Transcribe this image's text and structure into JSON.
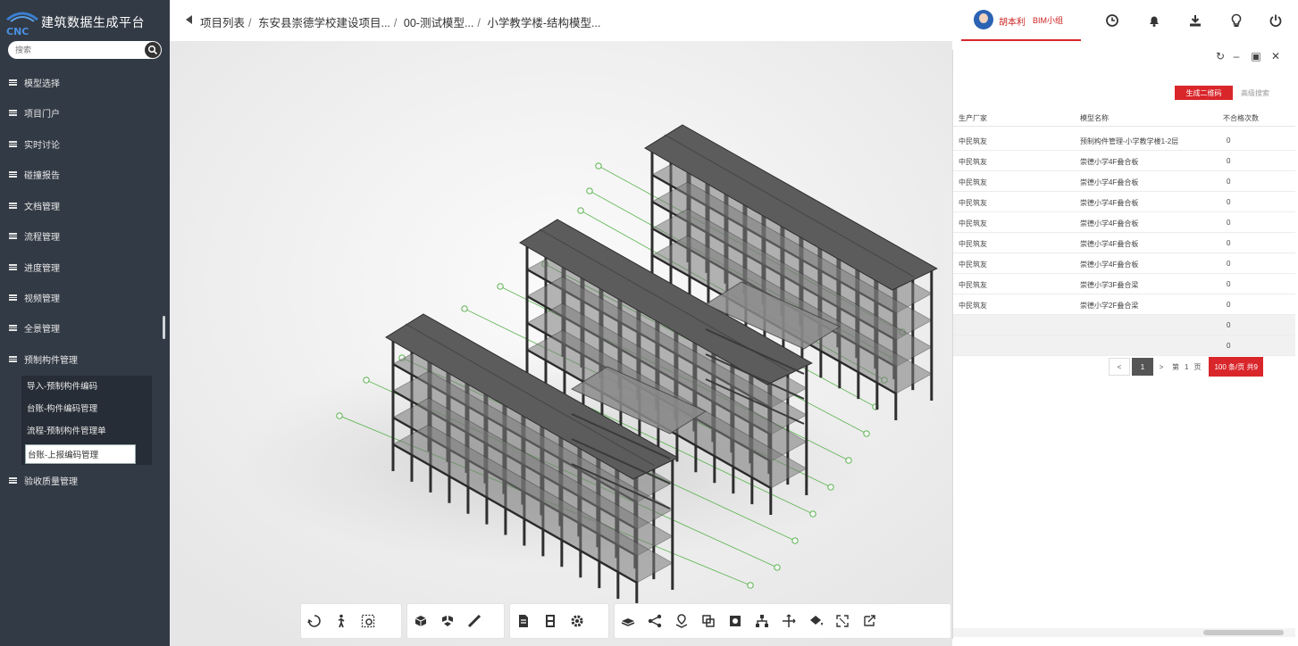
{
  "app": {
    "title": "建筑数据生成平台",
    "logo_text": "CNC"
  },
  "search": {
    "placeholder": "搜索"
  },
  "sidebar": {
    "items": [
      {
        "label": "模型选择"
      },
      {
        "label": "项目门户"
      },
      {
        "label": "实时讨论"
      },
      {
        "label": "碰撞报告"
      },
      {
        "label": "文档管理"
      },
      {
        "label": "流程管理"
      },
      {
        "label": "进度管理"
      },
      {
        "label": "视频管理"
      },
      {
        "label": "全景管理"
      },
      {
        "label": "预制构件管理"
      },
      {
        "label": "验收质量管理"
      }
    ],
    "submenu": [
      {
        "label": "导入-预制构件编码"
      },
      {
        "label": "台账-构件编码管理"
      },
      {
        "label": "流程-预制构件管理单"
      },
      {
        "label": "台账-上报编码管理"
      }
    ]
  },
  "breadcrumb": {
    "items": [
      "项目列表",
      "东安县崇德学校建设项目...",
      "00-测试模型...",
      "小学教学楼-结构模型..."
    ],
    "separator": "/"
  },
  "user": {
    "name": "胡本利",
    "role": "BIM小组"
  },
  "top_icons": [
    "clock-icon",
    "bell-icon",
    "download-icon",
    "lightbulb-icon",
    "power-icon"
  ],
  "toolbar": {
    "groups": [
      [
        "orbit-icon",
        "walk-icon",
        "zoom-window-icon"
      ],
      [
        "view-cube-icon",
        "explode-icon",
        "measure-icon"
      ],
      [
        "properties-icon",
        "save-icon",
        "settings-icon"
      ],
      [
        "model-tree-icon",
        "share-icon",
        "map-icon",
        "section-icon",
        "camera-icon",
        "hierarchy-icon",
        "move-icon",
        "bucket-icon",
        "fullscreen-icon",
        "export-icon"
      ]
    ]
  },
  "panel": {
    "tabs": {
      "active": "生成二维码",
      "other": "高级搜索"
    },
    "columns": [
      "生产厂家",
      "模型名称",
      "不合格次数"
    ],
    "rows": [
      {
        "maker": "中民筑友",
        "model": "预制构件管理-小学教学楼1-2层",
        "fails": "0"
      },
      {
        "maker": "中民筑友",
        "model": "崇德小学4F叠合板",
        "fails": "0"
      },
      {
        "maker": "中民筑友",
        "model": "崇德小学4F叠合板",
        "fails": "0"
      },
      {
        "maker": "中民筑友",
        "model": "崇德小学4F叠合板",
        "fails": "0"
      },
      {
        "maker": "中民筑友",
        "model": "崇德小学4F叠合板",
        "fails": "0"
      },
      {
        "maker": "中民筑友",
        "model": "崇德小学4F叠合板",
        "fails": "0"
      },
      {
        "maker": "中民筑友",
        "model": "崇德小学4F叠合板",
        "fails": "0"
      },
      {
        "maker": "中民筑友",
        "model": "崇德小学3F叠合梁",
        "fails": "0"
      },
      {
        "maker": "中民筑友",
        "model": "崇德小学2F叠合梁",
        "fails": "0"
      }
    ],
    "summary_rows": [
      "0",
      "0"
    ],
    "pagination": {
      "prev": "<",
      "current": "1",
      "next": ">",
      "goto_prefix": "第",
      "goto_value": "1",
      "goto_suffix": "页",
      "page_size": "100 条/页",
      "total": "共9"
    }
  },
  "colors": {
    "sidebar_bg": "#323a45",
    "accent_red": "#d9262b",
    "grid_green": "#4caf3f"
  }
}
